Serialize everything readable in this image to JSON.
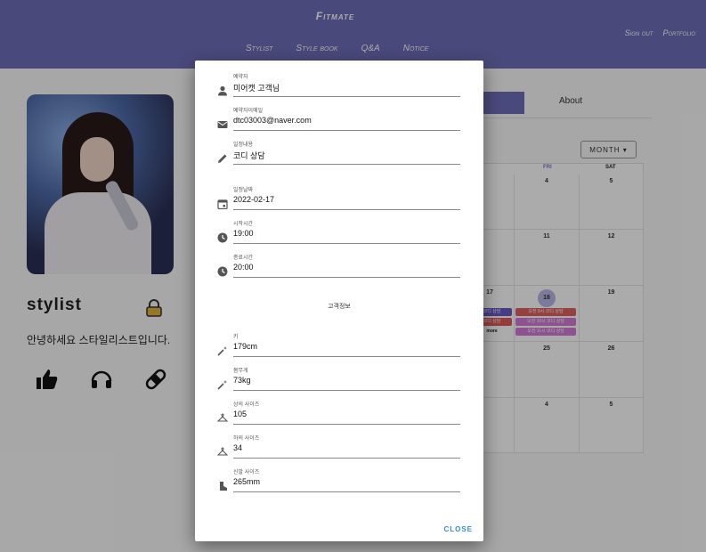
{
  "header": {
    "brand": "Fitmate",
    "nav": [
      "Stylist",
      "Style book",
      "Q&A",
      "Notice"
    ],
    "right_links": [
      "Sign out",
      "Portfolio"
    ]
  },
  "profile": {
    "username": "stylist",
    "greeting": "안녕하세요 스타일리스트입니다."
  },
  "tabs": {
    "about": "About"
  },
  "calendar": {
    "view_button": "MONTH",
    "day_headers": [
      "FRI",
      "SAT"
    ],
    "rows": [
      [
        "",
        "4",
        "5"
      ],
      [
        "",
        "11",
        "12"
      ],
      [
        "17",
        "18",
        "19"
      ],
      [
        "",
        "25",
        "26"
      ],
      [
        "",
        "4",
        "5"
      ]
    ],
    "events": [
      {
        "text": "코디 상담",
        "color": "#6a5acd"
      },
      {
        "text": "코디 상담",
        "color": "#e05a5a"
      },
      {
        "text": "more"
      },
      {
        "text": "오전 8시 코디 상담",
        "color": "#e06060"
      },
      {
        "text": "오전 10시 코디 상담",
        "color": "#d27bd6"
      },
      {
        "text": "오전 11시 코디 상담",
        "color": "#d27bd6"
      }
    ]
  },
  "dialog": {
    "fields": [
      {
        "label": "예약자",
        "value": "미어캣 고객님",
        "icon": "person-icon"
      },
      {
        "label": "예약자이메일",
        "value": "dtc03003@naver.com",
        "icon": "mail-icon"
      },
      {
        "label": "일정내용",
        "value": "코디 상담",
        "icon": "pencil-icon"
      },
      {
        "label": "일정날짜",
        "value": "2022-02-17",
        "icon": "calendar-icon"
      },
      {
        "label": "시작시간",
        "value": "19:00",
        "icon": "clock-icon"
      },
      {
        "label": "종료시간",
        "value": "20:00",
        "icon": "clock-icon"
      }
    ],
    "section_title": "고객정보",
    "customer_fields": [
      {
        "label": "키",
        "value": "179cm",
        "icon": "magic-wand-icon"
      },
      {
        "label": "몸무게",
        "value": "73kg",
        "icon": "magic-wand-icon"
      },
      {
        "label": "상의 사이즈",
        "value": "105",
        "icon": "hanger-icon"
      },
      {
        "label": "하의 사이즈",
        "value": "34",
        "icon": "hanger-icon"
      },
      {
        "label": "신발 사이즈",
        "value": "265mm",
        "icon": "boot-icon"
      }
    ],
    "close_label": "CLOSE"
  },
  "colors": {
    "header": "#6f6db9",
    "accent": "#2f8be6",
    "today": "#b9b7e6"
  }
}
